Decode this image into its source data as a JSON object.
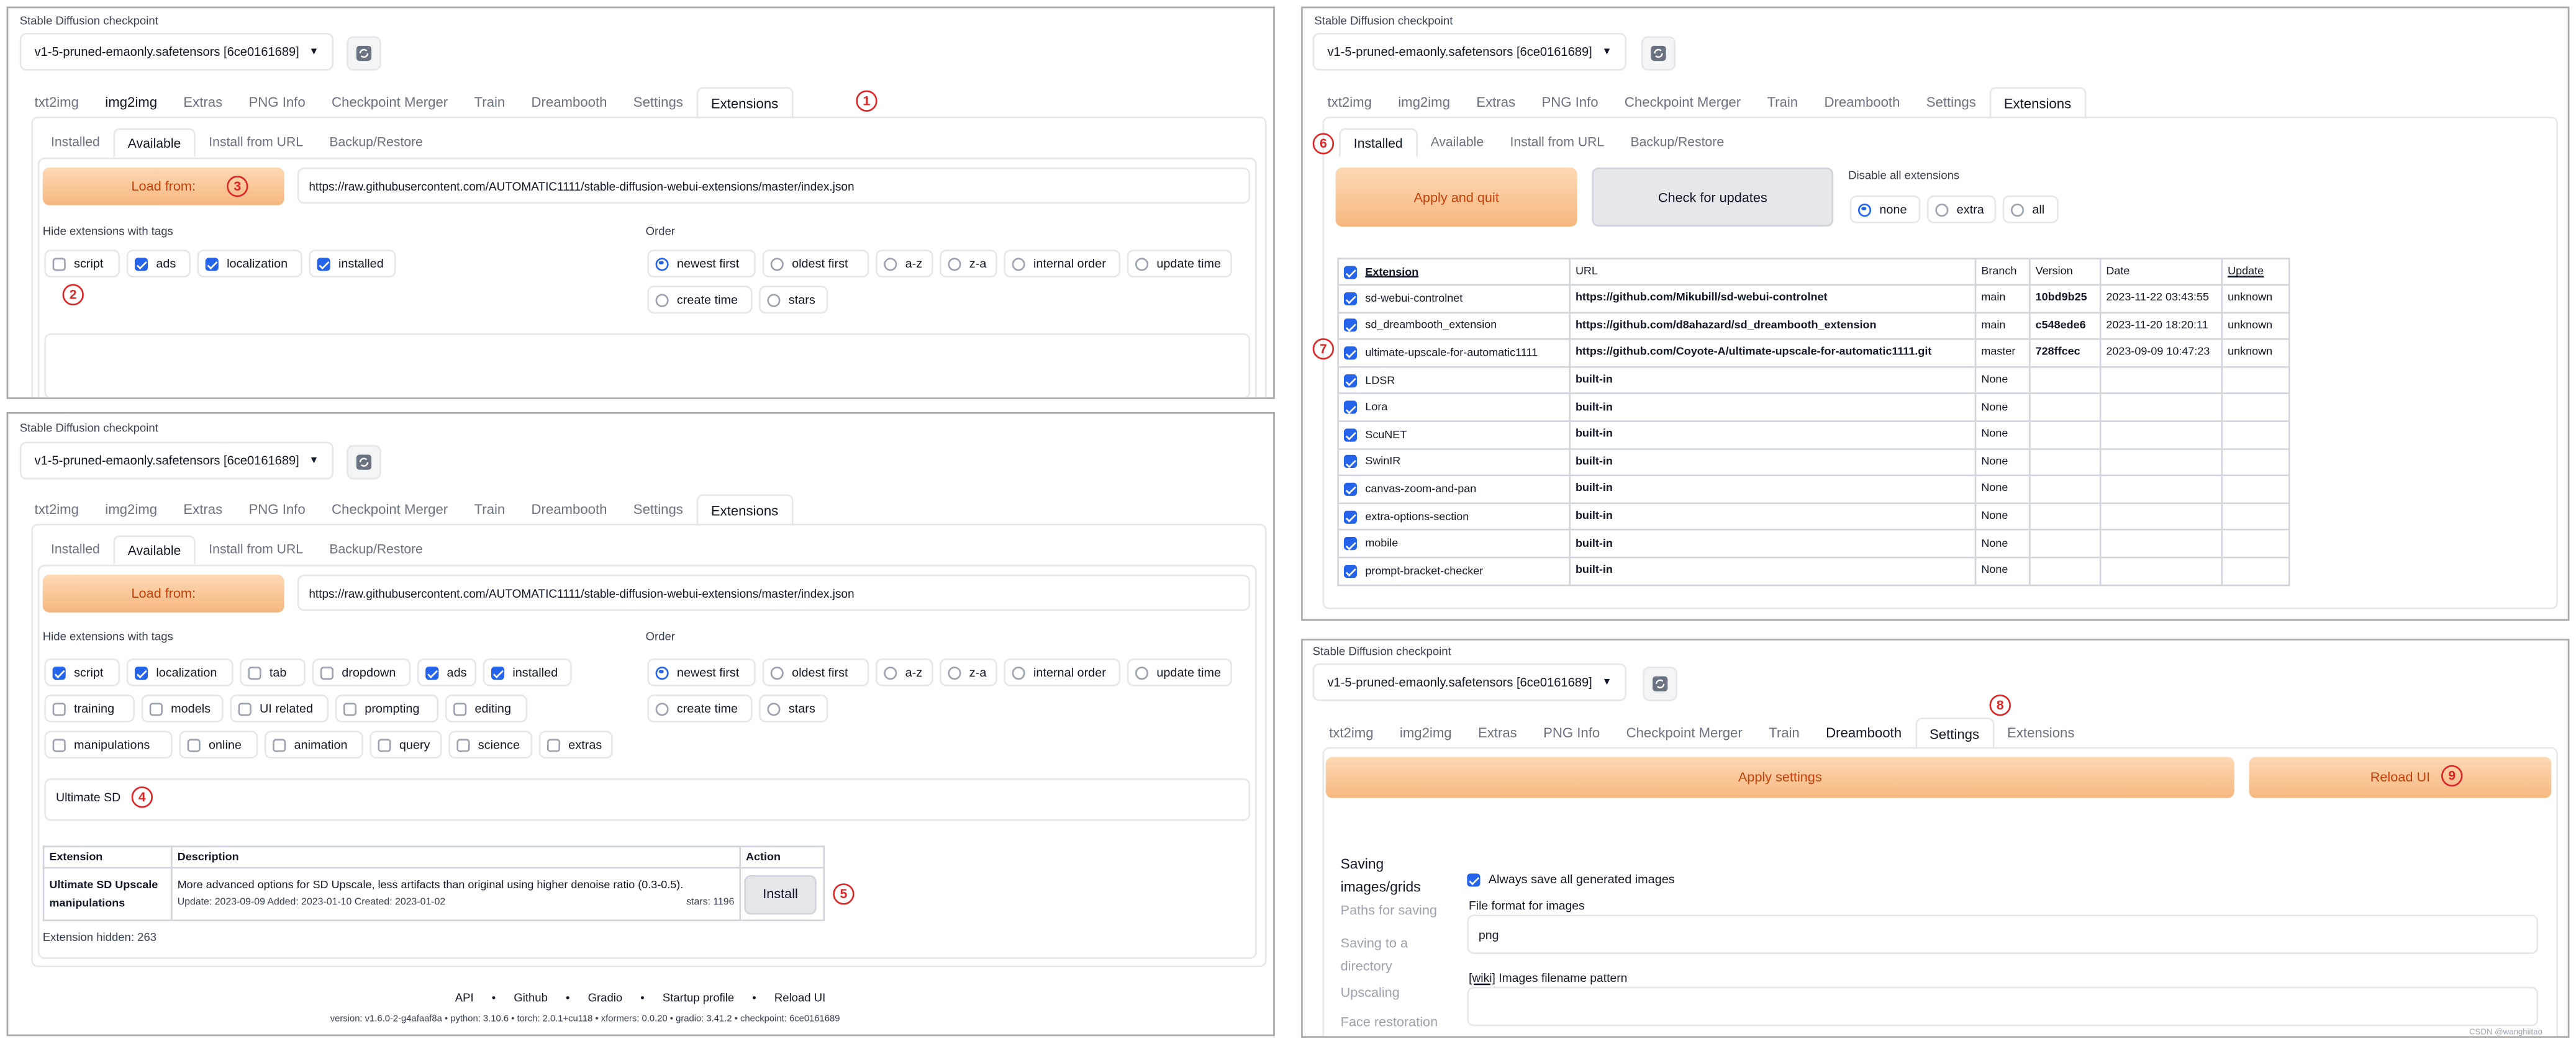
{
  "checkpoint_label": "Stable Diffusion checkpoint",
  "checkpoint_value": "v1-5-pruned-emaonly.safetensors [6ce0161689]",
  "main_tabs": [
    "txt2img",
    "img2img",
    "Extras",
    "PNG Info",
    "Checkpoint Merger",
    "Train",
    "Dreambooth",
    "Settings",
    "Extensions"
  ],
  "ext_tabs": [
    "Installed",
    "Available",
    "Install from URL",
    "Backup/Restore"
  ],
  "load_from": "Load from:",
  "index_url": "https://raw.githubusercontent.com/AUTOMATIC1111/stable-diffusion-webui-extensions/master/index.json",
  "hide_label": "Hide extensions with tags",
  "order_label": "Order",
  "tags": [
    "script",
    "ads",
    "localization",
    "installed",
    "tab",
    "dropdown",
    "training",
    "models",
    "UI related",
    "prompting",
    "editing",
    "manipulations",
    "online",
    "animation",
    "query",
    "science",
    "extras"
  ],
  "orders": [
    "newest first",
    "oldest first",
    "a-z",
    "z-a",
    "internal order",
    "update time",
    "create time",
    "stars"
  ],
  "search_value": "Ultimate SD",
  "avail_table": {
    "headers": [
      "Extension",
      "Description",
      "Action"
    ],
    "name": "Ultimate SD Upscale manipulations",
    "name_line1": "Ultimate SD Upscale",
    "name_line2": "manipulations",
    "desc": "More advanced options for SD Upscale, less artifacts than original using higher denoise ratio (0.3-0.5).",
    "dates": "Update: 2023-09-09 Added: 2023-01-10 Created: 2023-01-02",
    "stars": "stars: 1196",
    "install": "Install"
  },
  "ext_hidden": "Extension hidden: 263",
  "footer_links": [
    "API",
    "Github",
    "Gradio",
    "Startup profile",
    "Reload UI"
  ],
  "footer_sep": "•",
  "footer_version": "version: v1.6.0-2-g4afaaf8a  •  python: 3.10.6  •  torch: 2.0.1+cu118  •  xformers: 0.0.20  •  gradio: 3.41.2  •  checkpoint: 6ce0161689",
  "installed": {
    "apply_quit": "Apply and quit",
    "check_updates": "Check for updates",
    "disable_label": "Disable all extensions",
    "disable_opts": [
      "none",
      "extra",
      "all"
    ],
    "headers": [
      "Extension",
      "URL",
      "Branch",
      "Version",
      "Date",
      "Update"
    ],
    "rows": [
      [
        "sd-webui-controlnet",
        "https://github.com/Mikubill/sd-webui-controlnet",
        "main",
        "10bd9b25",
        "2023-11-22 03:43:55",
        "unknown"
      ],
      [
        "sd_dreambooth_extension",
        "https://github.com/d8ahazard/sd_dreambooth_extension",
        "main",
        "c548ede6",
        "2023-11-20 18:20:11",
        "unknown"
      ],
      [
        "ultimate-upscale-for-automatic1111",
        "https://github.com/Coyote-A/ultimate-upscale-for-automatic1111.git",
        "master",
        "728ffcec",
        "2023-09-09 10:47:23",
        "unknown"
      ],
      [
        "LDSR",
        "built-in",
        "None",
        "",
        "",
        ""
      ],
      [
        "Lora",
        "built-in",
        "None",
        "",
        "",
        ""
      ],
      [
        "ScuNET",
        "built-in",
        "None",
        "",
        "",
        ""
      ],
      [
        "SwinIR",
        "built-in",
        "None",
        "",
        "",
        ""
      ],
      [
        "canvas-zoom-and-pan",
        "built-in",
        "None",
        "",
        "",
        ""
      ],
      [
        "extra-options-section",
        "built-in",
        "None",
        "",
        "",
        ""
      ],
      [
        "mobile",
        "built-in",
        "None",
        "",
        "",
        ""
      ],
      [
        "prompt-bracket-checker",
        "built-in",
        "None",
        "",
        "",
        ""
      ]
    ]
  },
  "settings": {
    "apply": "Apply settings",
    "reload": "Reload UI",
    "nav": [
      "Saving images/grids",
      "Paths for saving",
      "Saving to a directory",
      "Upscaling",
      "Face restoration"
    ],
    "always_save": "Always save all generated images",
    "file_format_label": "File format for images",
    "file_format_value": "png",
    "wiki": "[wiki]",
    "pattern_label": "Images filename pattern"
  },
  "markers": [
    "1",
    "2",
    "3",
    "4",
    "5",
    "6",
    "7",
    "8",
    "9"
  ],
  "watermark": "CSDN @wanghiitao"
}
